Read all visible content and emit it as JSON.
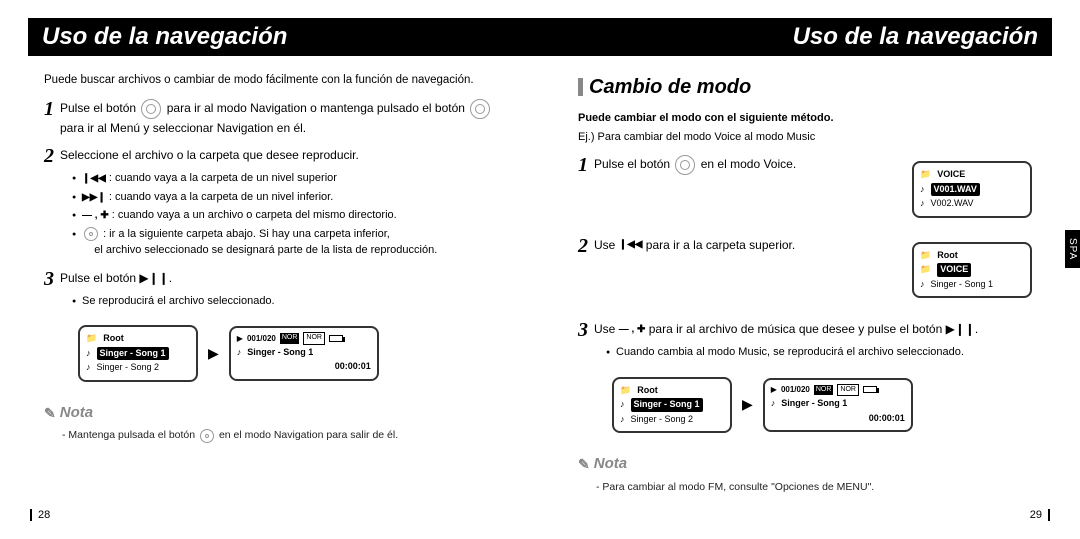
{
  "header": {
    "title": "Uso de la navegación"
  },
  "left": {
    "intro": "Puede buscar archivos o cambiar de modo fácilmente con la función de navegación.",
    "step1a": "Pulse el botón",
    "step1b": "para ir al modo Navigation o mantenga pulsado el botón",
    "step1c": "para ir al Menú y seleccionar Navigation en él.",
    "step2": "Seleccione el archivo o la carpeta que desee reproducir.",
    "b1": ": cuando vaya a la carpeta de un nivel superior",
    "b2": ": cuando vaya a la carpeta de un nivel inferior.",
    "b3": ": cuando vaya a un archivo o carpeta del mismo directorio.",
    "b4a": ": ir a la siguiente carpeta abajo. Si hay una carpeta inferior,",
    "b4b": "el archivo seleccionado se designará parte de la lista de reproducción.",
    "step3": "Pulse el botón ▶❙❙.",
    "step3sub": "Se reproducirá el archivo seleccionado.",
    "lcd1": {
      "root": "Root",
      "r1": "Singer - Song 1",
      "r2": "Singer - Song 2"
    },
    "lcd2": {
      "track": "001/020",
      "song": "Singer - Song 1",
      "time": "00:00:01"
    },
    "nota_title": "Nota",
    "nota_body_a": "- Mantenga pulsada el botón",
    "nota_body_b": "en el modo Navigation para salir de él.",
    "pagenum": "28"
  },
  "right": {
    "section_title": "Cambio de modo",
    "sub1": "Puede cambiar el modo con el siguiente método.",
    "sub2": "Ej.) Para cambiar del modo Voice al modo Music",
    "step1a": "Pulse el botón",
    "step1b": "en el modo Voice.",
    "step2a": "Use",
    "step2b": "para ir a la carpeta superior.",
    "step3a": "Use",
    "step3b": "para ir al archivo de música que desee y pulse el botón ▶❙❙.",
    "step3sub": "Cuando cambia al modo Music, se reproducirá el archivo seleccionado.",
    "lcd_voice": {
      "title": "VOICE",
      "r1": "V001.WAV",
      "r2": "V002.WAV"
    },
    "lcd_root": {
      "title": "Root",
      "hl": "VOICE",
      "r2": "Singer - Song 1"
    },
    "lcd_root2": {
      "title": "Root",
      "r1": "Singer - Song 1",
      "r2": "Singer - Song 2"
    },
    "lcd_play": {
      "track": "001/020",
      "song": "Singer - Song 1",
      "time": "00:00:01"
    },
    "nota_title": "Nota",
    "nota_body": "- Para cambiar al modo FM, consulte \"Opciones de MENU\".",
    "pagenum": "29",
    "spa": "SPA"
  },
  "icons": {
    "rewind": "❙◀◀",
    "ff": "▶▶❙",
    "minusplus": "— , ✚",
    "play": "▶"
  }
}
